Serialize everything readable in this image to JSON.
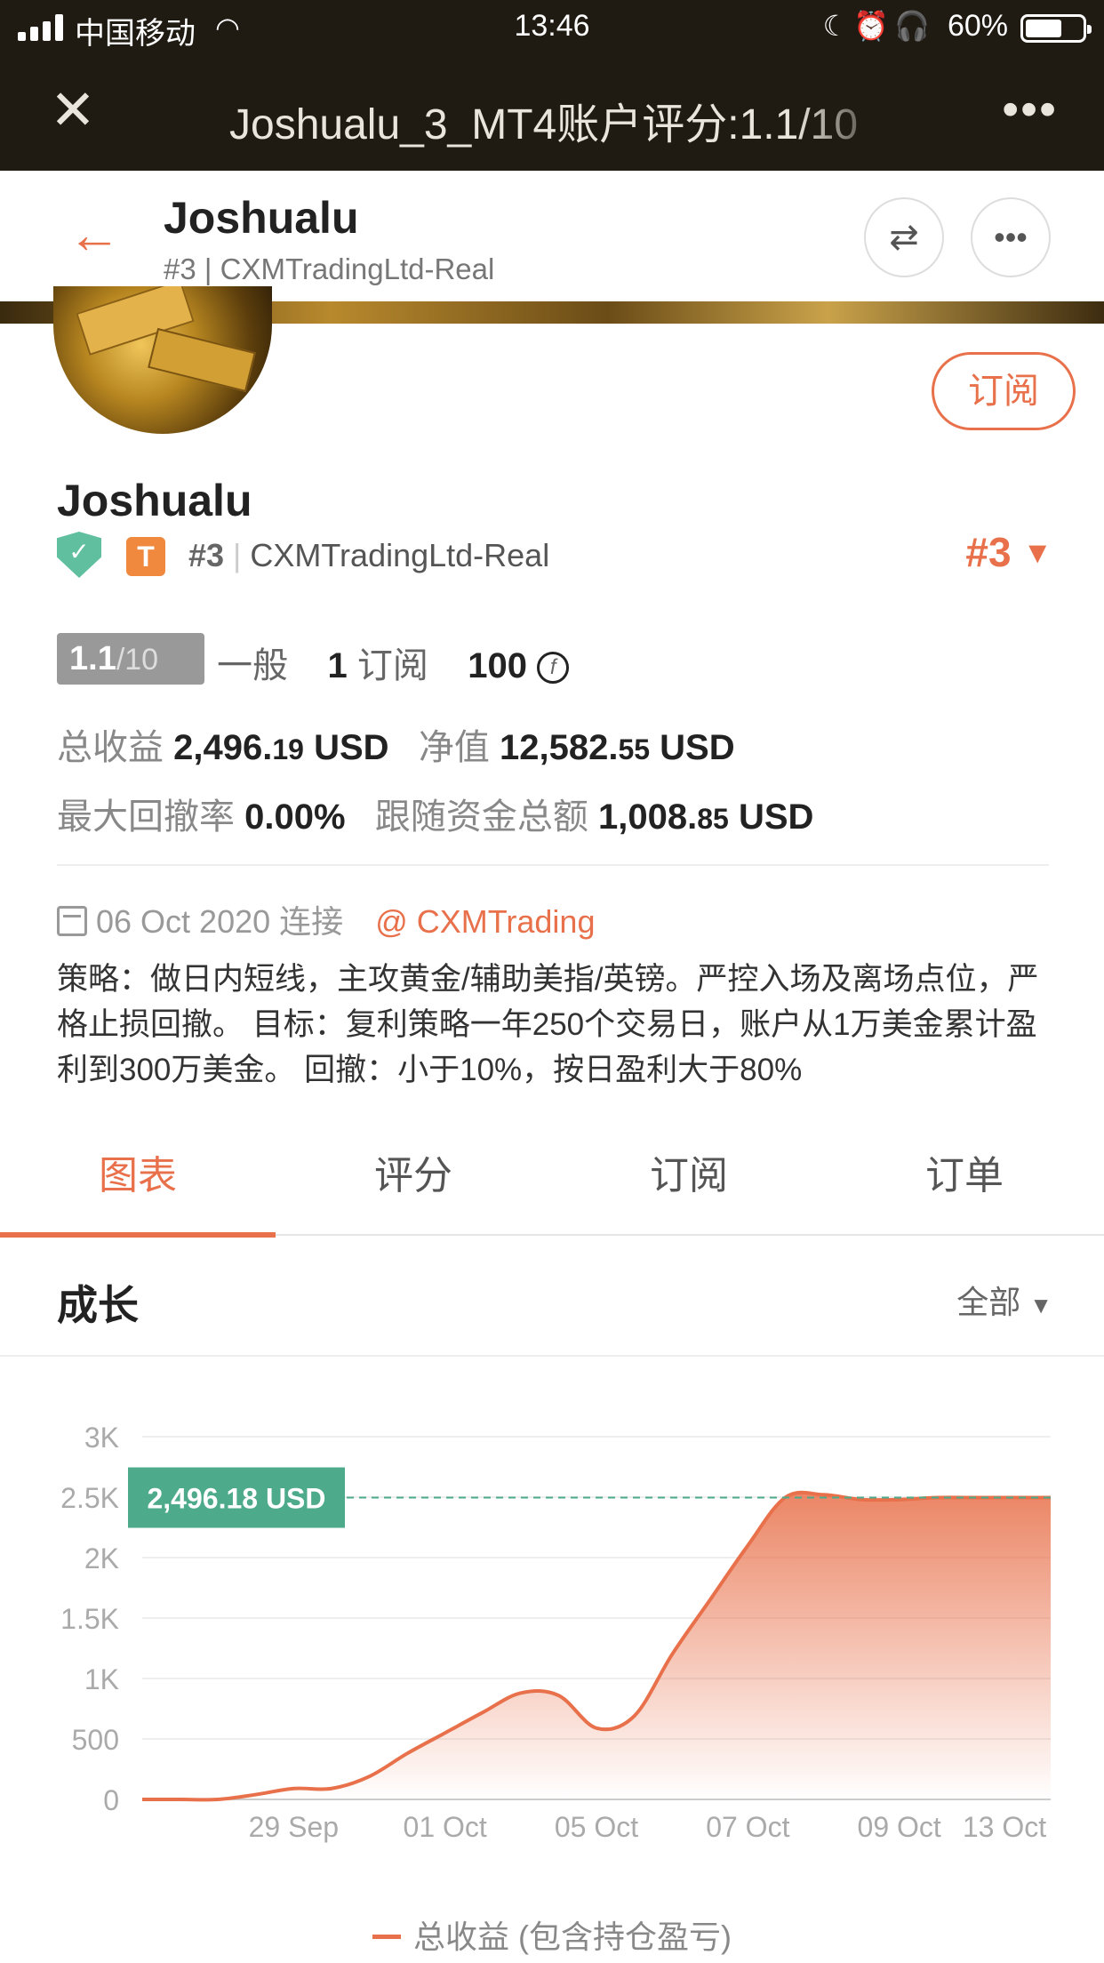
{
  "status_bar": {
    "carrier": "中国移动",
    "time": "13:46",
    "battery": "60%"
  },
  "webview": {
    "title": "Joshualu_3_MT4账户评分:1.1/10"
  },
  "app_bar": {
    "name": "Joshualu",
    "subtitle": "#3 | CXMTradingLtd-Real"
  },
  "profile": {
    "subscribe_label": "订阅",
    "name": "Joshualu",
    "shield_icon": "shield-check-icon",
    "tier_badge": "T",
    "rank": "#3",
    "broker": "CXMTradingLtd-Real",
    "rank_right": "#3"
  },
  "score": {
    "value": "1.1",
    "out_of": "/10",
    "level": "一般",
    "subscribers": "1",
    "subscribers_label": "订阅",
    "coins": "100",
    "coin_glyph": "f"
  },
  "stats": {
    "total_profit_label": "总收益",
    "total_profit_int": "2,496.",
    "total_profit_dec": "19",
    "currency": "USD",
    "equity_label": "净值",
    "equity_int": "12,582.",
    "equity_dec": "55",
    "max_dd_label": "最大回撤率",
    "max_dd": "0.00%",
    "follow_funds_label": "跟随资金总额",
    "follow_funds_int": "1,008.",
    "follow_funds_dec": "85"
  },
  "connect": {
    "date": "06 Oct 2020",
    "label": "连接",
    "account": "@ CXMTrading"
  },
  "strategy": "策略：做日内短线，主攻黄金/辅助美指/英镑。严控入场及离场点位，严格止损回撤。 目标：复利策略一年250个交易日，账户从1万美金累计盈利到300万美金。 回撤：小于10%，按日盈利大于80%",
  "tabs": [
    "图表",
    "评分",
    "订阅",
    "订单"
  ],
  "growth": {
    "title": "成长",
    "filter": "全部"
  },
  "chart_data": {
    "type": "area",
    "y_ticks": [
      "3K",
      "2.5K",
      "2K",
      "1.5K",
      "1K",
      "500",
      "0"
    ],
    "ylim": [
      0,
      3000
    ],
    "x_ticks": [
      "29 Sep",
      "01 Oct",
      "05 Oct",
      "07 Oct",
      "09 Oct",
      "13 Oct"
    ],
    "x": [
      0,
      0.5,
      1,
      1.5,
      2,
      2.5,
      3,
      3.5,
      4,
      4.5,
      5,
      5.5,
      6,
      6.5,
      7,
      7.5,
      8,
      8.5,
      9,
      9.5,
      10,
      10.5,
      11,
      11.5,
      12
    ],
    "values": [
      0,
      0,
      0,
      40,
      90,
      90,
      190,
      380,
      550,
      720,
      880,
      860,
      590,
      690,
      1200,
      1650,
      2100,
      2500,
      2520,
      2480,
      2480,
      2496,
      2496,
      2496,
      2496
    ],
    "current_label": "2,496.18 USD",
    "current_value": 2496.18,
    "legend": "总收益 (包含持仓盈亏)",
    "line_color": "#e8704a",
    "label_color": "#4daa8a"
  }
}
